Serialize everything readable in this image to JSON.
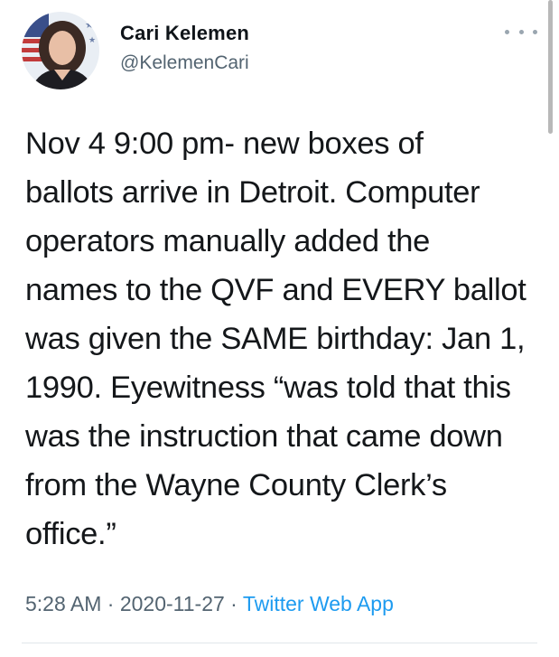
{
  "author": {
    "name": "Cari Kelemen",
    "handle": "@KelemenCari",
    "avatar": "profile-photo"
  },
  "tweet": {
    "lines": [
      "Nov 4 9:00 pm- new boxes of",
      "ballots arrive in Detroit. Computer",
      "operators manually added the",
      "names to the QVF and EVERY ballot",
      "was given the SAME birthday: Jan 1,",
      "1990. Eyewitness “was told that this",
      "was the instruction that came down",
      "from the Wayne County Clerk’s",
      "office.”"
    ]
  },
  "meta": {
    "time": "5:28 AM",
    "separator1": " · ",
    "date": "2020-11-27",
    "separator2": " · ",
    "app": "Twitter Web App"
  },
  "icons": {
    "more": "more-horizontal-icon"
  },
  "colors": {
    "text": "#14171a",
    "secondary": "#536471",
    "link": "#1d9bf0"
  }
}
